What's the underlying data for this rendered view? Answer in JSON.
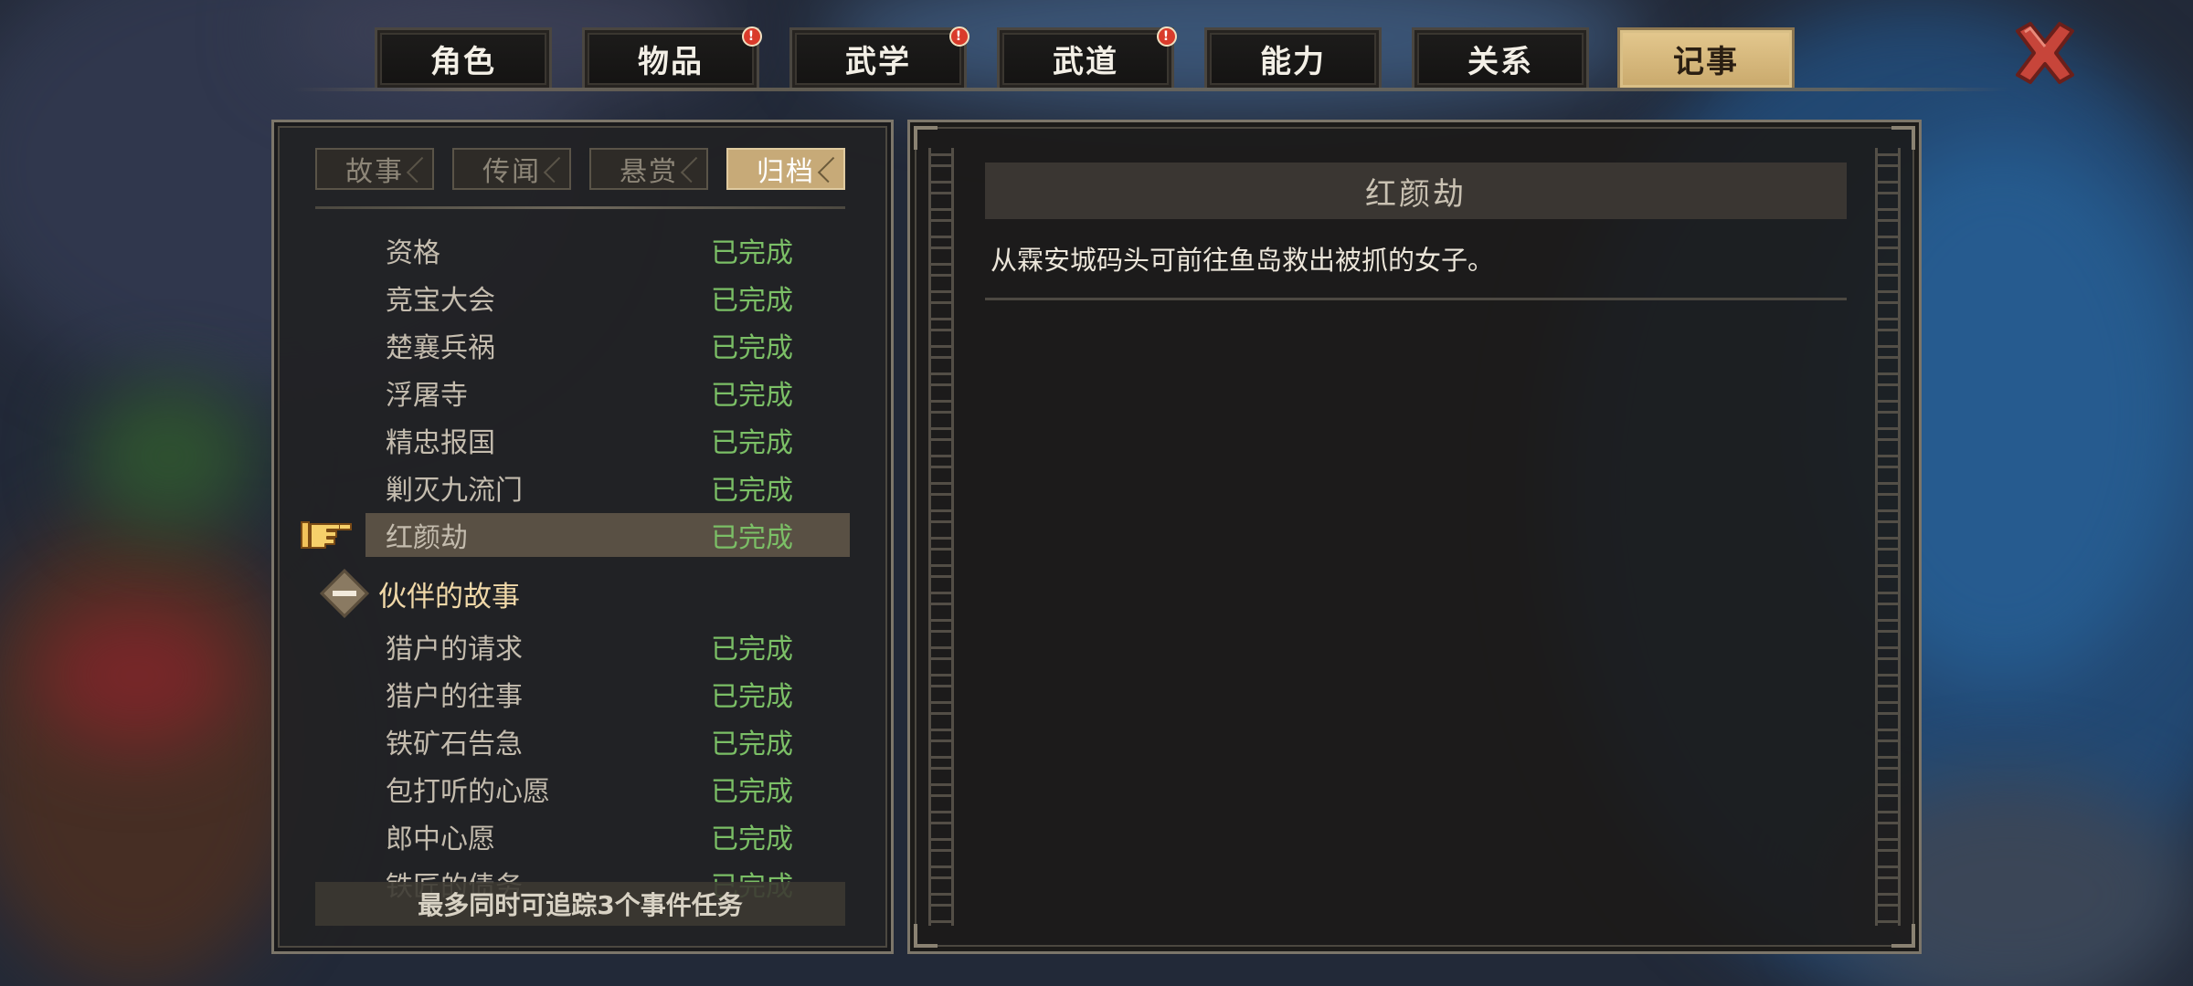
{
  "tabs": [
    {
      "label": "角色",
      "alert": false,
      "active": false
    },
    {
      "label": "物品",
      "alert": true,
      "active": false
    },
    {
      "label": "武学",
      "alert": true,
      "active": false
    },
    {
      "label": "武道",
      "alert": true,
      "active": false
    },
    {
      "label": "能力",
      "alert": false,
      "active": false
    },
    {
      "label": "关系",
      "alert": false,
      "active": false
    },
    {
      "label": "记事",
      "alert": false,
      "active": true
    }
  ],
  "alert_glyph": "!",
  "subtabs": [
    {
      "label": "故事",
      "active": false
    },
    {
      "label": "传闻",
      "active": false
    },
    {
      "label": "悬赏",
      "active": false
    },
    {
      "label": "归档",
      "active": true
    }
  ],
  "quests": [
    {
      "name": "资格",
      "status": "已完成"
    },
    {
      "name": "竞宝大会",
      "status": "已完成"
    },
    {
      "name": "楚襄兵祸",
      "status": "已完成"
    },
    {
      "name": "浮屠寺",
      "status": "已完成"
    },
    {
      "name": "精忠报国",
      "status": "已完成"
    },
    {
      "name": "剿灭九流门",
      "status": "已完成"
    },
    {
      "name": "红颜劫",
      "status": "已完成",
      "selected": true
    }
  ],
  "companion_group": {
    "label": "伙伴的故事",
    "quests": [
      {
        "name": "猎户的请求",
        "status": "已完成"
      },
      {
        "name": "猎户的往事",
        "status": "已完成"
      },
      {
        "name": "铁矿石告急",
        "status": "已完成"
      },
      {
        "name": "包打听的心愿",
        "status": "已完成"
      },
      {
        "name": "郎中心愿",
        "status": "已完成"
      },
      {
        "name": "铁匠的债务",
        "status": "已完成"
      }
    ]
  },
  "footer_hint": "最多同时可追踪3个事件任务",
  "detail": {
    "title": "红颜劫",
    "description": "从霖安城码头可前往鱼岛救出被抓的女子。"
  },
  "colors": {
    "completed": "#7bbf66",
    "active_tab": "#d9bf86",
    "alert": "#d93b2b"
  },
  "icons": {
    "close": "close-x-icon",
    "pointer": "pointing-hand-icon",
    "collapse": "collapse-minus-icon"
  }
}
